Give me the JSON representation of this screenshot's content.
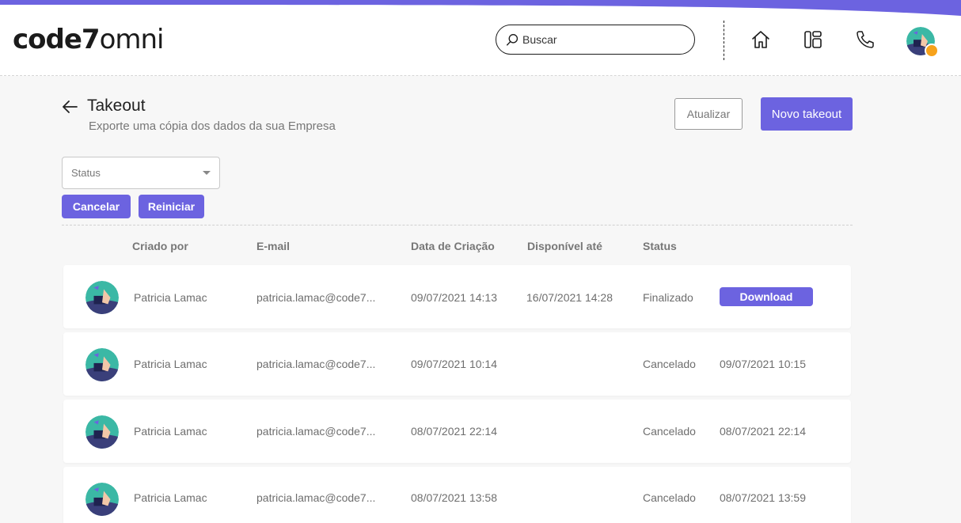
{
  "header": {
    "logo_bold": "code7",
    "logo_light": "omni",
    "search_placeholder": "Buscar",
    "icons": [
      "home-icon",
      "layout-icon",
      "phone-icon"
    ]
  },
  "page": {
    "title": "Takeout",
    "subtitle": "Exporte uma cópia dos dados da sua Empresa",
    "refresh_label": "Atualizar",
    "new_label": "Novo takeout"
  },
  "filters": {
    "status_placeholder": "Status",
    "cancel_label": "Cancelar",
    "restart_label": "Reiniciar"
  },
  "table": {
    "columns": [
      "Criado por",
      "E-mail",
      "Data de Criação",
      "Disponível até",
      "Status"
    ],
    "rows": [
      {
        "name": "Patricia Lamac",
        "email": "patricia.lamac@code7...",
        "created": "09/07/2021 14:13",
        "available": "16/07/2021 14:28",
        "status": "Finalizado",
        "action": "Download"
      },
      {
        "name": "Patricia Lamac",
        "email": "patricia.lamac@code7...",
        "created": "09/07/2021 10:14",
        "available": "",
        "status": "Cancelado",
        "action": "09/07/2021 10:15"
      },
      {
        "name": "Patricia Lamac",
        "email": "patricia.lamac@code7...",
        "created": "08/07/2021 22:14",
        "available": "",
        "status": "Cancelado",
        "action": "08/07/2021 22:14"
      },
      {
        "name": "Patricia Lamac",
        "email": "patricia.lamac@code7...",
        "created": "08/07/2021 13:58",
        "available": "",
        "status": "Cancelado",
        "action": "08/07/2021 13:59"
      }
    ]
  },
  "colors": {
    "accent": "#6c63e0",
    "status_dot": "#f7a21b"
  }
}
